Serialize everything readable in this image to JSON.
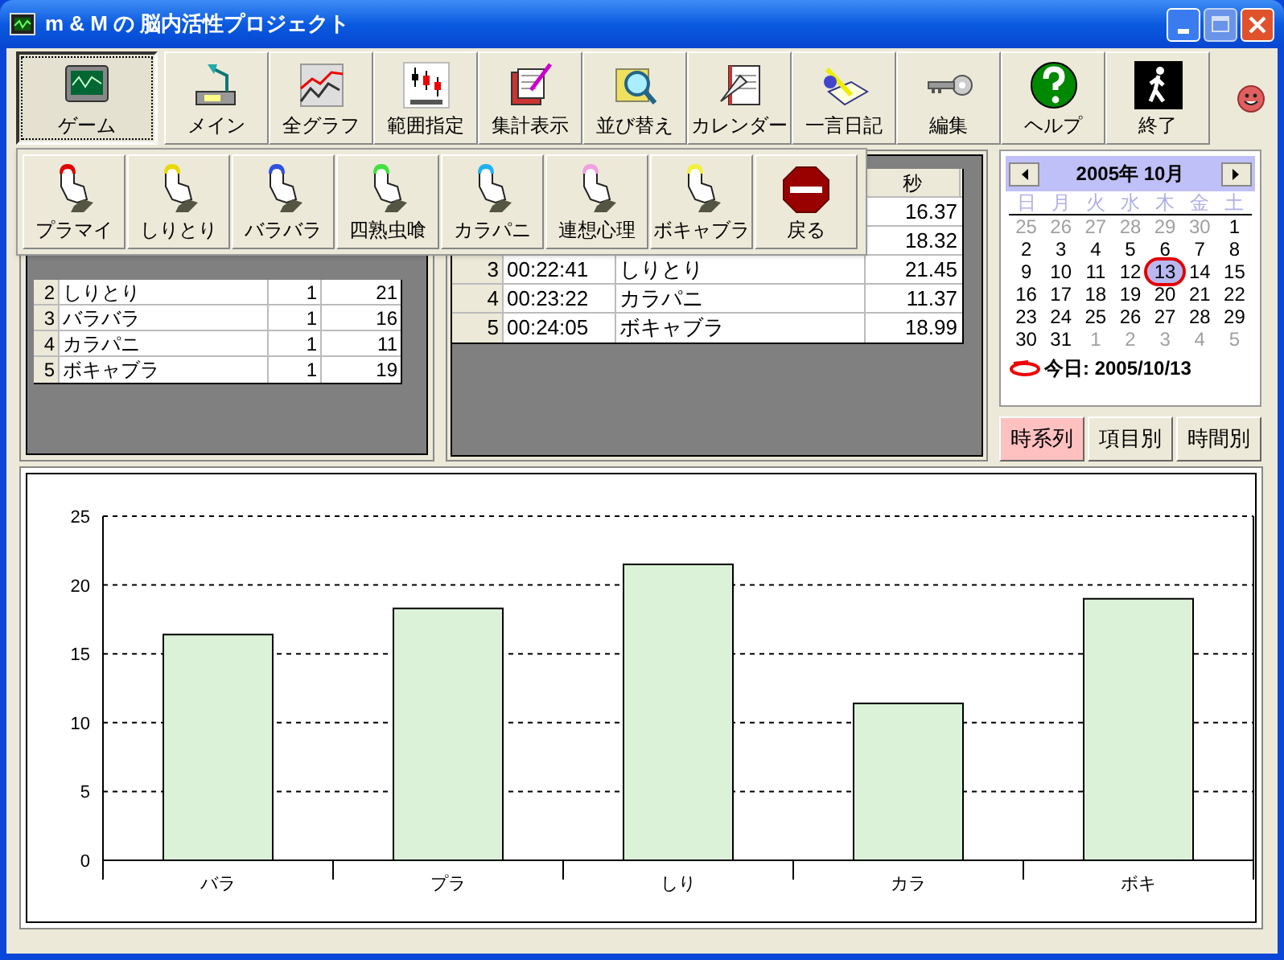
{
  "window": {
    "title": "m & M の 脳内活性プロジェクト"
  },
  "toolbar": [
    {
      "label": "ゲーム",
      "selected": true
    },
    {
      "label": "メイン",
      "selected": false
    },
    {
      "label": "全グラフ",
      "selected": false
    },
    {
      "label": "範囲指定",
      "selected": false
    },
    {
      "label": "集計表示",
      "selected": false
    },
    {
      "label": "並び替え",
      "selected": false
    },
    {
      "label": "カレンダー",
      "selected": false
    },
    {
      "label": "一言日記",
      "selected": false
    },
    {
      "label": "編集",
      "selected": false
    },
    {
      "label": "ヘルプ",
      "selected": false
    },
    {
      "label": "終了",
      "selected": false
    }
  ],
  "game_menu": [
    {
      "label": "プラマイ",
      "kind": "game",
      "color": "#e00000"
    },
    {
      "label": "しりとり",
      "kind": "game",
      "color": "#e8d800"
    },
    {
      "label": "バラバラ",
      "kind": "game",
      "color": "#3050e0"
    },
    {
      "label": "四熟虫喰",
      "kind": "game",
      "color": "#40e040"
    },
    {
      "label": "カラパニ",
      "kind": "game",
      "color": "#20b0f0"
    },
    {
      "label": "連想心理",
      "kind": "game",
      "color": "#f0a0e0"
    },
    {
      "label": "ボキャブラ",
      "kind": "game",
      "color": "#f0f040"
    },
    {
      "label": "戻る",
      "kind": "stop"
    }
  ],
  "game_summary": {
    "rows": [
      {
        "no": "2",
        "name": "しりとり",
        "count": "1",
        "score": "21"
      },
      {
        "no": "3",
        "name": "バラバラ",
        "count": "1",
        "score": "16"
      },
      {
        "no": "4",
        "name": "カラパニ",
        "count": "1",
        "score": "11"
      },
      {
        "no": "5",
        "name": "ボキャブラ",
        "count": "1",
        "score": "19"
      }
    ]
  },
  "records": {
    "seconds_header": "秒",
    "rows": [
      {
        "seconds": "16.37"
      },
      {
        "seconds": "18.32"
      },
      {
        "no": "3",
        "time": "00:22:41",
        "game": "しりとり",
        "seconds": "21.45"
      },
      {
        "no": "4",
        "time": "00:23:22",
        "game": "カラパニ",
        "seconds": "11.37"
      },
      {
        "no": "5",
        "time": "00:24:05",
        "game": "ボキャブラ",
        "seconds": "18.99"
      }
    ]
  },
  "calendar": {
    "month": "2005年 10月",
    "weekdays": [
      "日",
      "月",
      "火",
      "水",
      "木",
      "金",
      "土"
    ],
    "days": [
      {
        "day": "25",
        "in_month": false,
        "selected": false
      },
      {
        "day": "26",
        "in_month": false,
        "selected": false
      },
      {
        "day": "27",
        "in_month": false,
        "selected": false
      },
      {
        "day": "28",
        "in_month": false,
        "selected": false
      },
      {
        "day": "29",
        "in_month": false,
        "selected": false
      },
      {
        "day": "30",
        "in_month": false,
        "selected": false
      },
      {
        "day": "1",
        "in_month": true,
        "selected": false
      },
      {
        "day": "2",
        "in_month": true,
        "selected": false
      },
      {
        "day": "3",
        "in_month": true,
        "selected": false
      },
      {
        "day": "4",
        "in_month": true,
        "selected": false
      },
      {
        "day": "5",
        "in_month": true,
        "selected": false
      },
      {
        "day": "6",
        "in_month": true,
        "selected": false
      },
      {
        "day": "7",
        "in_month": true,
        "selected": false
      },
      {
        "day": "8",
        "in_month": true,
        "selected": false
      },
      {
        "day": "9",
        "in_month": true,
        "selected": false
      },
      {
        "day": "10",
        "in_month": true,
        "selected": false
      },
      {
        "day": "11",
        "in_month": true,
        "selected": false
      },
      {
        "day": "12",
        "in_month": true,
        "selected": false
      },
      {
        "day": "13",
        "in_month": true,
        "selected": true
      },
      {
        "day": "14",
        "in_month": true,
        "selected": false
      },
      {
        "day": "15",
        "in_month": true,
        "selected": false
      },
      {
        "day": "16",
        "in_month": true,
        "selected": false
      },
      {
        "day": "17",
        "in_month": true,
        "selected": false
      },
      {
        "day": "18",
        "in_month": true,
        "selected": false
      },
      {
        "day": "19",
        "in_month": true,
        "selected": false
      },
      {
        "day": "20",
        "in_month": true,
        "selected": false
      },
      {
        "day": "21",
        "in_month": true,
        "selected": false
      },
      {
        "day": "22",
        "in_month": true,
        "selected": false
      },
      {
        "day": "23",
        "in_month": true,
        "selected": false
      },
      {
        "day": "24",
        "in_month": true,
        "selected": false
      },
      {
        "day": "25",
        "in_month": true,
        "selected": false
      },
      {
        "day": "26",
        "in_month": true,
        "selected": false
      },
      {
        "day": "27",
        "in_month": true,
        "selected": false
      },
      {
        "day": "28",
        "in_month": true,
        "selected": false
      },
      {
        "day": "29",
        "in_month": true,
        "selected": false
      },
      {
        "day": "30",
        "in_month": true,
        "selected": false
      },
      {
        "day": "31",
        "in_month": true,
        "selected": false
      },
      {
        "day": "1",
        "in_month": false,
        "selected": false
      },
      {
        "day": "2",
        "in_month": false,
        "selected": false
      },
      {
        "day": "3",
        "in_month": false,
        "selected": false
      },
      {
        "day": "4",
        "in_month": false,
        "selected": false
      },
      {
        "day": "5",
        "in_month": false,
        "selected": false
      }
    ],
    "today": "今日: 2005/10/13"
  },
  "view_buttons": [
    {
      "label": "時系列",
      "selected": true
    },
    {
      "label": "項目別",
      "selected": false
    },
    {
      "label": "時間別",
      "selected": false
    }
  ],
  "chart_data": {
    "type": "bar",
    "categories": [
      "バラ",
      "プラ",
      "しり",
      "カラ",
      "ボキ"
    ],
    "values": [
      16.4,
      18.3,
      21.5,
      11.4,
      19.0
    ],
    "grid": true,
    "ylim": [
      0,
      25
    ],
    "yticks": [
      0,
      5,
      10,
      15,
      20,
      25
    ]
  }
}
